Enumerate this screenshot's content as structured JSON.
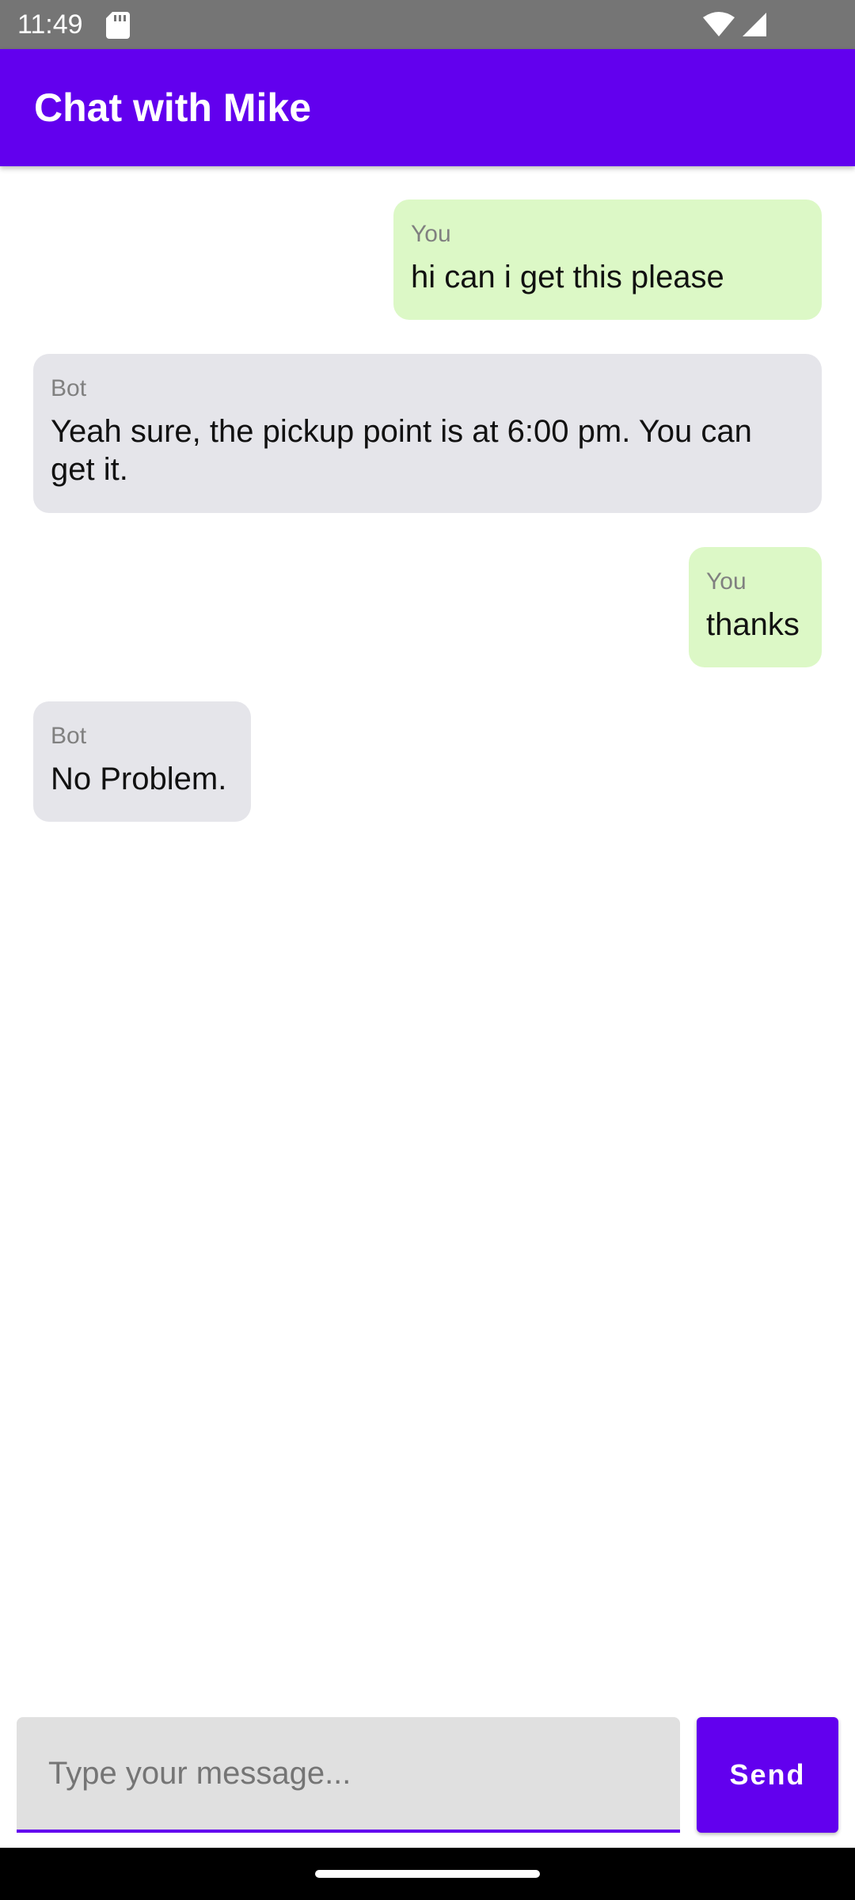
{
  "status_bar": {
    "time": "11:49",
    "icons": [
      "sd-card-icon",
      "wifi-icon",
      "signal-icon"
    ]
  },
  "app_bar": {
    "title": "Chat with Mike",
    "color": "#6200EE"
  },
  "messages": [
    {
      "sender": "You",
      "text": "hi can i get this please",
      "type": "user"
    },
    {
      "sender": "Bot",
      "text": "Yeah sure, the pickup point is at 6:00 pm. You can get it.",
      "type": "bot"
    },
    {
      "sender": "You",
      "text": "thanks",
      "type": "user"
    },
    {
      "sender": "Bot",
      "text": "No Problem.",
      "type": "bot"
    }
  ],
  "composer": {
    "placeholder": "Type your message...",
    "value": "",
    "send_label": "Send"
  },
  "colors": {
    "user_bubble": "#DCF8C6",
    "bot_bubble": "#E5E5EA",
    "accent": "#6200EE"
  }
}
